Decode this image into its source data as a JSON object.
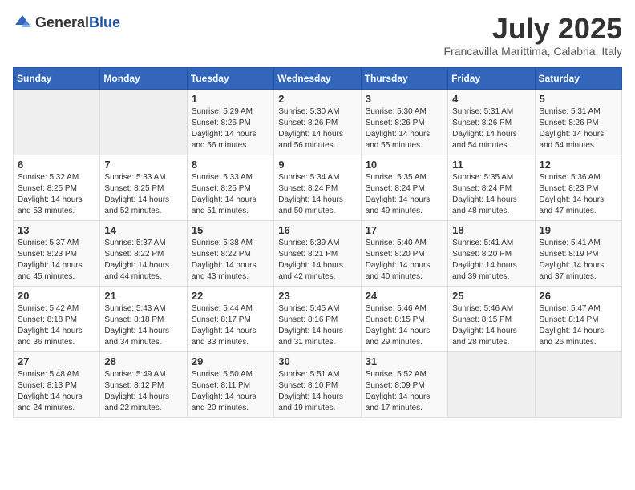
{
  "header": {
    "logo_general": "General",
    "logo_blue": "Blue",
    "month_title": "July 2025",
    "subtitle": "Francavilla Marittima, Calabria, Italy"
  },
  "days_of_week": [
    "Sunday",
    "Monday",
    "Tuesday",
    "Wednesday",
    "Thursday",
    "Friday",
    "Saturday"
  ],
  "weeks": [
    [
      {
        "day": "",
        "info": ""
      },
      {
        "day": "",
        "info": ""
      },
      {
        "day": "1",
        "info": "Sunrise: 5:29 AM\nSunset: 8:26 PM\nDaylight: 14 hours and 56 minutes."
      },
      {
        "day": "2",
        "info": "Sunrise: 5:30 AM\nSunset: 8:26 PM\nDaylight: 14 hours and 56 minutes."
      },
      {
        "day": "3",
        "info": "Sunrise: 5:30 AM\nSunset: 8:26 PM\nDaylight: 14 hours and 55 minutes."
      },
      {
        "day": "4",
        "info": "Sunrise: 5:31 AM\nSunset: 8:26 PM\nDaylight: 14 hours and 54 minutes."
      },
      {
        "day": "5",
        "info": "Sunrise: 5:31 AM\nSunset: 8:26 PM\nDaylight: 14 hours and 54 minutes."
      }
    ],
    [
      {
        "day": "6",
        "info": "Sunrise: 5:32 AM\nSunset: 8:25 PM\nDaylight: 14 hours and 53 minutes."
      },
      {
        "day": "7",
        "info": "Sunrise: 5:33 AM\nSunset: 8:25 PM\nDaylight: 14 hours and 52 minutes."
      },
      {
        "day": "8",
        "info": "Sunrise: 5:33 AM\nSunset: 8:25 PM\nDaylight: 14 hours and 51 minutes."
      },
      {
        "day": "9",
        "info": "Sunrise: 5:34 AM\nSunset: 8:24 PM\nDaylight: 14 hours and 50 minutes."
      },
      {
        "day": "10",
        "info": "Sunrise: 5:35 AM\nSunset: 8:24 PM\nDaylight: 14 hours and 49 minutes."
      },
      {
        "day": "11",
        "info": "Sunrise: 5:35 AM\nSunset: 8:24 PM\nDaylight: 14 hours and 48 minutes."
      },
      {
        "day": "12",
        "info": "Sunrise: 5:36 AM\nSunset: 8:23 PM\nDaylight: 14 hours and 47 minutes."
      }
    ],
    [
      {
        "day": "13",
        "info": "Sunrise: 5:37 AM\nSunset: 8:23 PM\nDaylight: 14 hours and 45 minutes."
      },
      {
        "day": "14",
        "info": "Sunrise: 5:37 AM\nSunset: 8:22 PM\nDaylight: 14 hours and 44 minutes."
      },
      {
        "day": "15",
        "info": "Sunrise: 5:38 AM\nSunset: 8:22 PM\nDaylight: 14 hours and 43 minutes."
      },
      {
        "day": "16",
        "info": "Sunrise: 5:39 AM\nSunset: 8:21 PM\nDaylight: 14 hours and 42 minutes."
      },
      {
        "day": "17",
        "info": "Sunrise: 5:40 AM\nSunset: 8:20 PM\nDaylight: 14 hours and 40 minutes."
      },
      {
        "day": "18",
        "info": "Sunrise: 5:41 AM\nSunset: 8:20 PM\nDaylight: 14 hours and 39 minutes."
      },
      {
        "day": "19",
        "info": "Sunrise: 5:41 AM\nSunset: 8:19 PM\nDaylight: 14 hours and 37 minutes."
      }
    ],
    [
      {
        "day": "20",
        "info": "Sunrise: 5:42 AM\nSunset: 8:18 PM\nDaylight: 14 hours and 36 minutes."
      },
      {
        "day": "21",
        "info": "Sunrise: 5:43 AM\nSunset: 8:18 PM\nDaylight: 14 hours and 34 minutes."
      },
      {
        "day": "22",
        "info": "Sunrise: 5:44 AM\nSunset: 8:17 PM\nDaylight: 14 hours and 33 minutes."
      },
      {
        "day": "23",
        "info": "Sunrise: 5:45 AM\nSunset: 8:16 PM\nDaylight: 14 hours and 31 minutes."
      },
      {
        "day": "24",
        "info": "Sunrise: 5:46 AM\nSunset: 8:15 PM\nDaylight: 14 hours and 29 minutes."
      },
      {
        "day": "25",
        "info": "Sunrise: 5:46 AM\nSunset: 8:15 PM\nDaylight: 14 hours and 28 minutes."
      },
      {
        "day": "26",
        "info": "Sunrise: 5:47 AM\nSunset: 8:14 PM\nDaylight: 14 hours and 26 minutes."
      }
    ],
    [
      {
        "day": "27",
        "info": "Sunrise: 5:48 AM\nSunset: 8:13 PM\nDaylight: 14 hours and 24 minutes."
      },
      {
        "day": "28",
        "info": "Sunrise: 5:49 AM\nSunset: 8:12 PM\nDaylight: 14 hours and 22 minutes."
      },
      {
        "day": "29",
        "info": "Sunrise: 5:50 AM\nSunset: 8:11 PM\nDaylight: 14 hours and 20 minutes."
      },
      {
        "day": "30",
        "info": "Sunrise: 5:51 AM\nSunset: 8:10 PM\nDaylight: 14 hours and 19 minutes."
      },
      {
        "day": "31",
        "info": "Sunrise: 5:52 AM\nSunset: 8:09 PM\nDaylight: 14 hours and 17 minutes."
      },
      {
        "day": "",
        "info": ""
      },
      {
        "day": "",
        "info": ""
      }
    ]
  ]
}
